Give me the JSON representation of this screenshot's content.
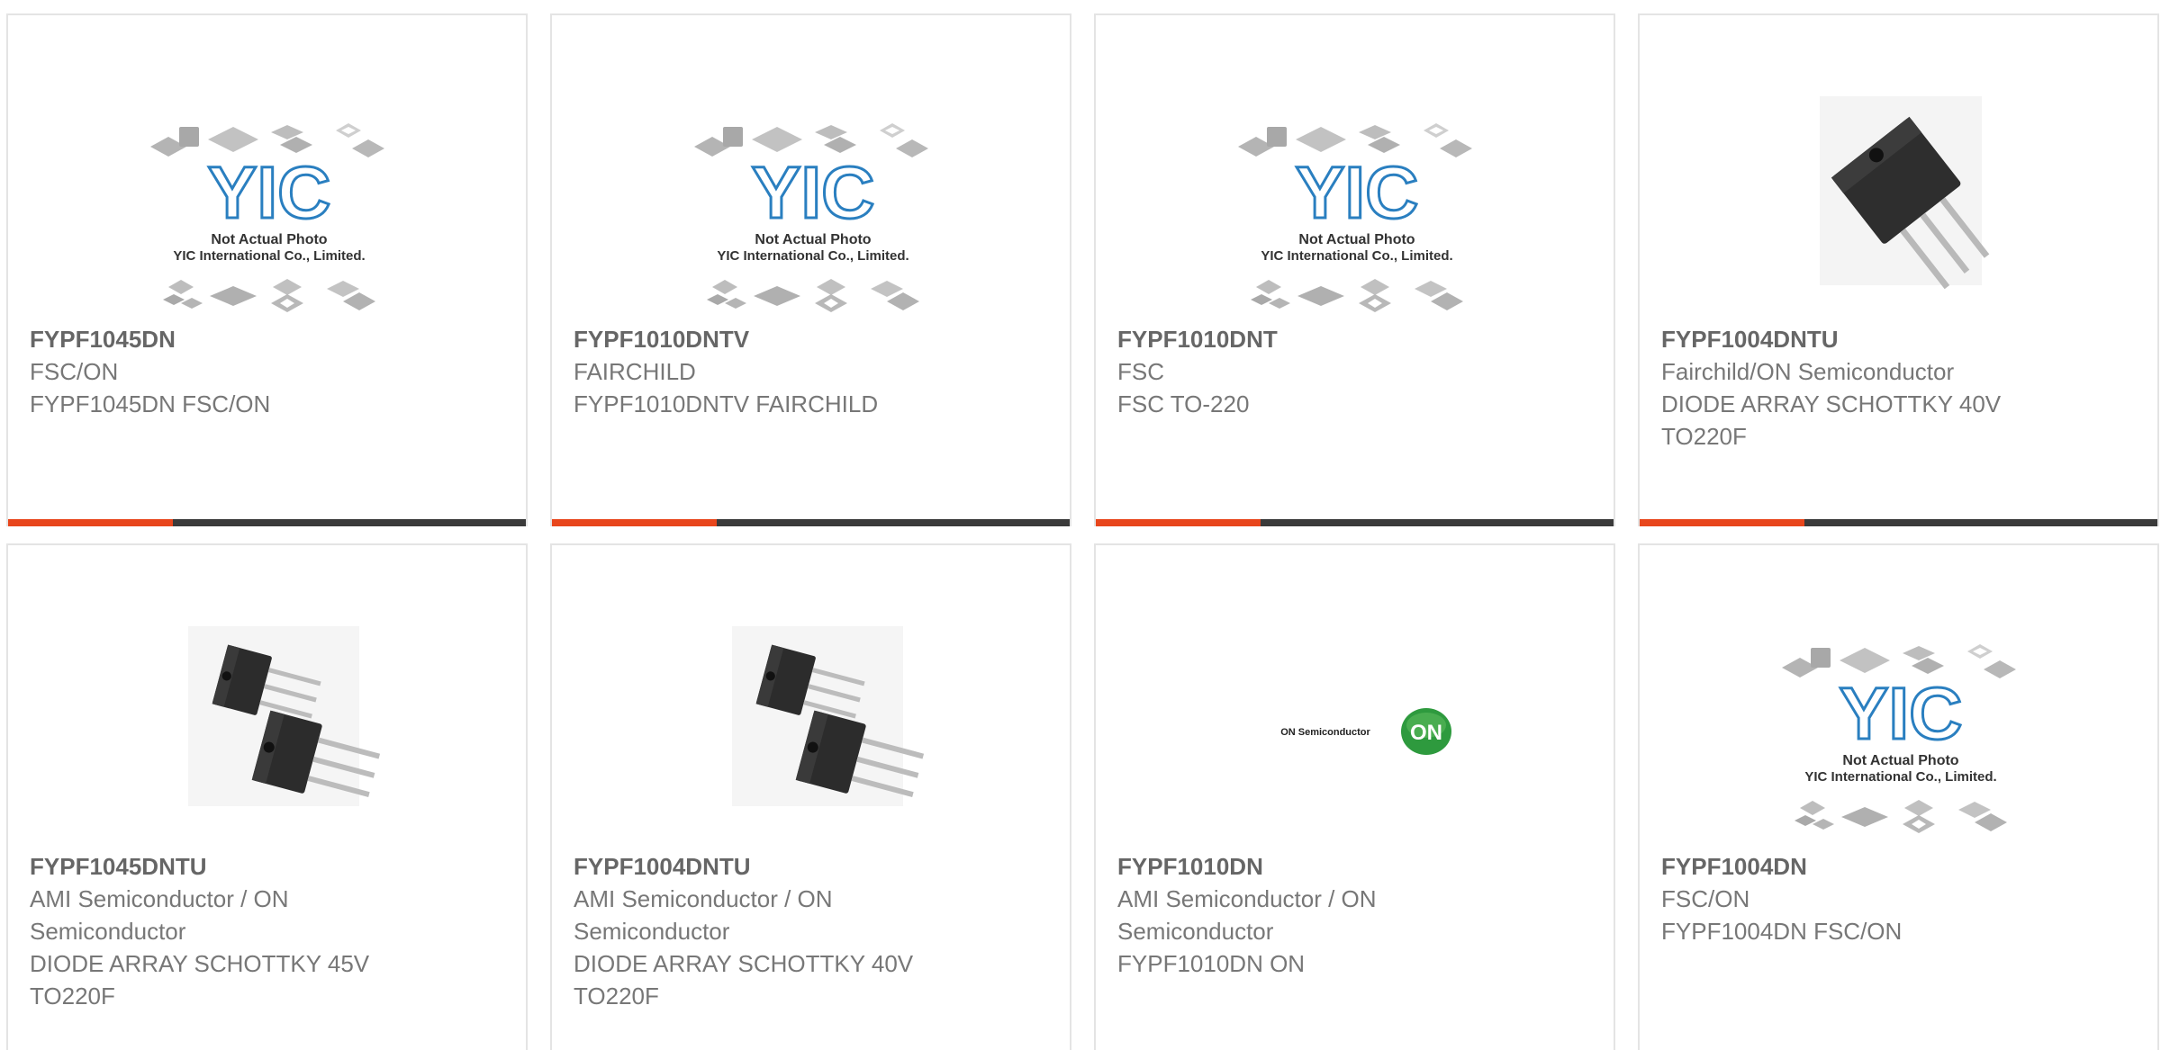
{
  "colors": {
    "accent": "#e8461c",
    "bar": "#3a3a3a",
    "card_border": "#e4e4e4",
    "text": "#666666",
    "yic_blue": "#2a7fc0",
    "on_green": "#2e9a3e"
  },
  "placeholder": {
    "logo": "YIC",
    "line1": "Not Actual Photo",
    "line2": "YIC International Co., Limited."
  },
  "on_logo": {
    "text": "ON Semiconductor",
    "badge": "ON"
  },
  "products": [
    {
      "image": "yic-placeholder",
      "name": "FYPF1045DN",
      "manufacturer": "FSC/ON",
      "description": [
        "FYPF1045DN FSC/ON"
      ]
    },
    {
      "image": "yic-placeholder",
      "name": "FYPF1010DNTV",
      "manufacturer": "FAIRCHILD",
      "description": [
        "FYPF1010DNTV FAIRCHILD"
      ]
    },
    {
      "image": "yic-placeholder",
      "name": "FYPF1010DNT",
      "manufacturer": "FSC",
      "description": [
        "FSC TO-220"
      ]
    },
    {
      "image": "to220-single",
      "name": "FYPF1004DNTU",
      "manufacturer": "Fairchild/ON Semiconductor",
      "description": [
        "DIODE ARRAY SCHOTTKY 40V",
        "TO220F"
      ]
    },
    {
      "image": "to220-pair",
      "name": "FYPF1045DNTU",
      "manufacturer": "AMI Semiconductor / ON",
      "manufacturer2": "Semiconductor",
      "description": [
        "DIODE ARRAY SCHOTTKY 45V",
        "TO220F"
      ]
    },
    {
      "image": "to220-pair",
      "name": "FYPF1004DNTU",
      "manufacturer": "AMI Semiconductor / ON",
      "manufacturer2": "Semiconductor",
      "description": [
        "DIODE ARRAY SCHOTTKY 40V",
        "TO220F"
      ]
    },
    {
      "image": "on-semiconductor-logo",
      "name": "FYPF1010DN",
      "manufacturer": "AMI Semiconductor / ON",
      "manufacturer2": "Semiconductor",
      "description": [
        "FYPF1010DN ON"
      ]
    },
    {
      "image": "yic-placeholder",
      "name": "FYPF1004DN",
      "manufacturer": "FSC/ON",
      "description": [
        "FYPF1004DN FSC/ON"
      ]
    }
  ]
}
